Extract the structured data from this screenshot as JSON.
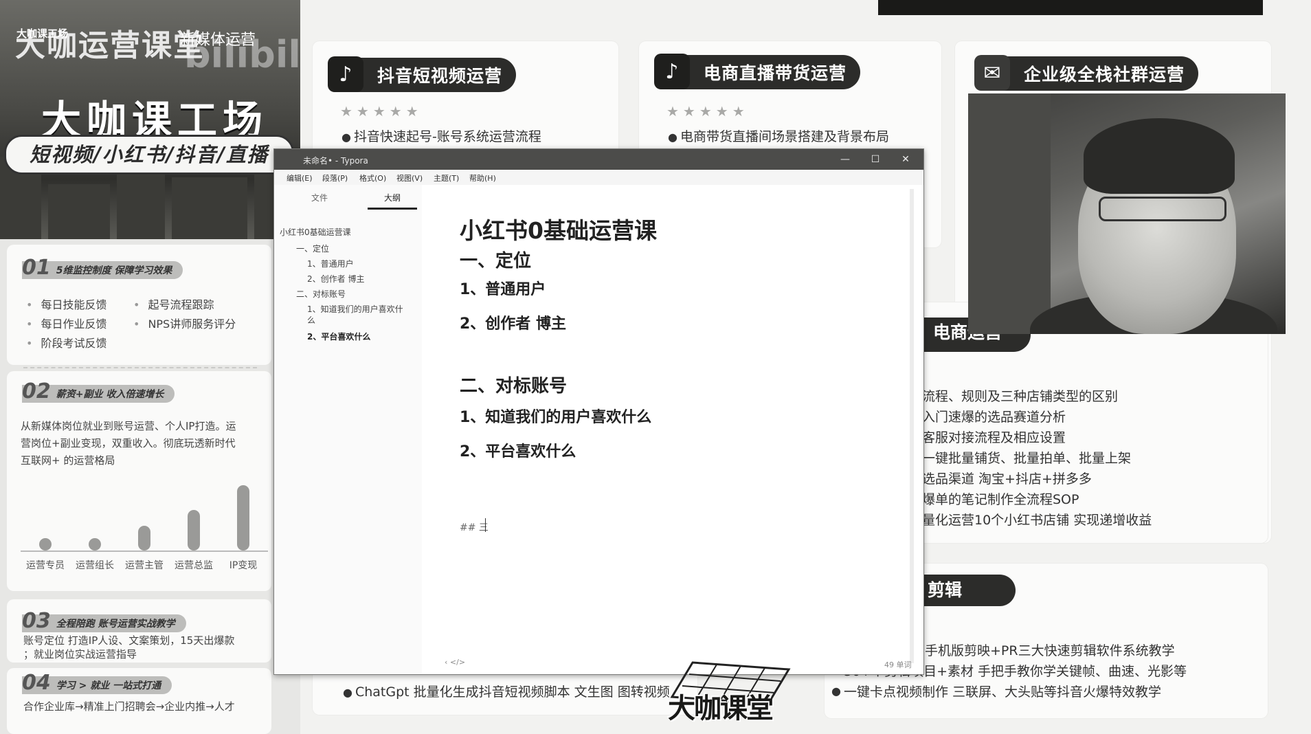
{
  "banner": {
    "logo_text": "大咖运营课堂",
    "logo_small": "大咖课工场",
    "brand_text": "新媒体运营",
    "bili_text": "bilibili",
    "headline": "大咖课工场",
    "pill_text": "短视频/小红书/抖音/直播"
  },
  "section1": {
    "num": "01",
    "title": "5维监控制度 保障学习效果",
    "items": [
      "每日技能反馈",
      "起号流程跟踪",
      "每日作业反馈",
      "NPS讲师服务评分",
      "阶段考试反馈"
    ]
  },
  "section2": {
    "num": "02",
    "title": "薪资+副业 收入倍速增长",
    "desc_lines": [
      "从新媒体岗位就业到账号运营、个人IP打造。运",
      "营岗位+副业变现，双重收入。彻底玩透新时代",
      "互联网+ 的运营格局"
    ],
    "chart_data": {
      "type": "bar",
      "categories": [
        "运营专员",
        "运营组长",
        "运营主管",
        "运营总监",
        "IP变现"
      ],
      "values": [
        1,
        1.5,
        3,
        5,
        8
      ]
    }
  },
  "section3": {
    "num": "03",
    "title": "全程陪跑 账号运营实战教学",
    "desc_lines": [
      "账号定位 打造IP人设、文案策划，15天出爆款",
      "；就业岗位实战运营指导"
    ]
  },
  "section4": {
    "num": "04",
    "title": "学习 > 就业 一站式打通",
    "desc_lines": [
      "合作企业库→精准上门招聘会→企业内推→人才"
    ]
  },
  "programs": [
    {
      "title": "抖音短视频运营",
      "icon": "tiktok-icon",
      "stars": "★★★★★",
      "line": "抖音快速起号-账号系统运营流程"
    },
    {
      "title": "电商直播带货运营",
      "icon": "tiktok-icon",
      "stars": "★★★★★",
      "line": "电商带货直播间场景搭建及背景布局"
    },
    {
      "title": "企业级全栈社群运营",
      "icon": "wechat-icon",
      "stars": "",
      "line": ""
    }
  ],
  "ecommerce": {
    "title_partial": "电商运营",
    "lines": [
      "流程、规则及三种店铺类型的区别",
      "入门速爆的选品赛道分析",
      "客服对接流程及相应设置",
      "一键批量铺货、批量拍单、批量上架",
      "选品渠道 淘宝+抖店+拼多多",
      "爆单的笔记制作全流程SOP",
      "量化运营10个小红书店铺 实现递增收益"
    ]
  },
  "editing": {
    "title_partial": "剪辑",
    "lines": [
      "手机版剪映+PR三大快速剪辑软件系统教学",
      "30+个剪辑项目+素材 手把手教你学关键帧、曲速、光影等",
      "一键卡点视频制作 三联屏、大头贴等抖音火爆特效教学"
    ]
  },
  "bottom_lines": {
    "chatgpt": "ChatGpt 批量化生成抖音短视频脚本 文生图 图转视频"
  },
  "typora": {
    "window_title": "未命名• - Typora",
    "menu": [
      "编辑(E)",
      "段落(P)",
      "格式(O)",
      "视图(V)",
      "主题(T)",
      "帮助(H)"
    ],
    "sidebar_tabs": [
      "文件",
      "大纲"
    ],
    "outline": [
      "小红书0基础运营课",
      "一、定位",
      "1、普通用户",
      "2、创作者 博主",
      "二、对标账号",
      "1、知道我们的用户喜欢什",
      "么",
      "2、平台喜欢什么"
    ],
    "doc": {
      "h1": "小红书0基础运营课",
      "h2_1": "一、定位",
      "item_1": "1、普通用户",
      "item_2": "2、创作者 博主",
      "h2_2": "二、对标账号",
      "item_3": "1、知道我们的用户喜欢什么",
      "item_4": "2、平台喜欢什么",
      "raw_line": "## 三"
    },
    "status_nav": "‹  </>",
    "word_count": "49 单词"
  },
  "watermark": "大咖课堂"
}
